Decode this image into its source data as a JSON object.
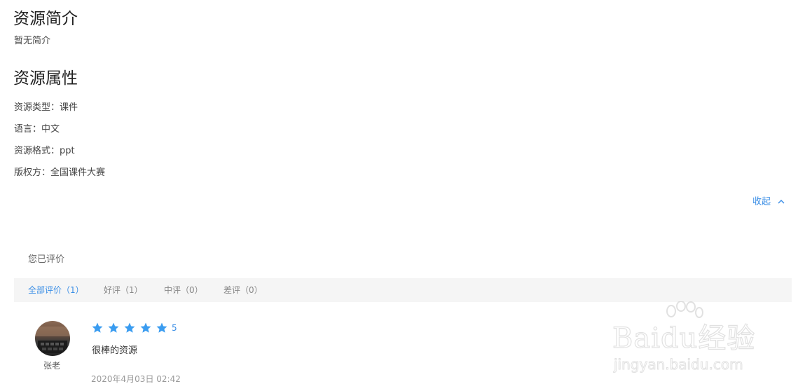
{
  "intro": {
    "title": "资源简介",
    "text": "暂无简介"
  },
  "attributes": {
    "title": "资源属性",
    "items": [
      "资源类型：课件",
      "语言：中文",
      "资源格式：ppt",
      "版权方：全国课件大赛"
    ]
  },
  "collapse": {
    "label": "收起",
    "icon": "chevron-up-icon"
  },
  "review": {
    "rated_text": "您已评价",
    "tabs": [
      {
        "label": "全部评价（1）",
        "active": true
      },
      {
        "label": "好评（1）",
        "active": false
      },
      {
        "label": "中评（0）",
        "active": false
      },
      {
        "label": "差评（0）",
        "active": false
      }
    ],
    "items": [
      {
        "user": "张老",
        "rating": 5,
        "score_text": "5",
        "text": "很棒的资源",
        "time": "2020年4月03日 02:42"
      }
    ]
  },
  "watermark": {
    "brand": "Baidu经验",
    "url": "jingyan.baidu.com"
  },
  "colors": {
    "accent": "#3a8ee6",
    "star": "#3a9cf0",
    "filter_bar_bg": "#f5f5f5"
  }
}
